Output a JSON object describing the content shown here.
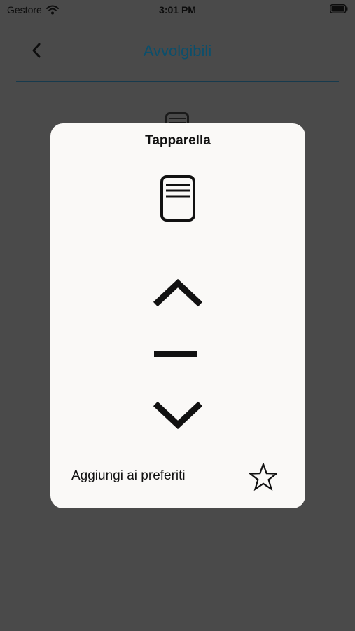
{
  "status_bar": {
    "carrier": "Gestore",
    "time": "3:01 PM"
  },
  "header": {
    "title": "Avvolgibili",
    "back_icon": "chevron-left-icon"
  },
  "modal": {
    "title": "Tapparella",
    "device_icon": "roller-shutter-icon",
    "controls": {
      "up_icon": "chevron-up-icon",
      "stop_icon": "minus-icon",
      "down_icon": "chevron-down-icon"
    },
    "favorites_label": "Aggiungi ai preferiti",
    "favorite_icon": "star-outline-icon"
  },
  "colors": {
    "overlay_bg": "#4a4a4a",
    "card_bg": "#faf9f7",
    "title_accent": "#0b4f6c",
    "divider": "#173a4d"
  }
}
